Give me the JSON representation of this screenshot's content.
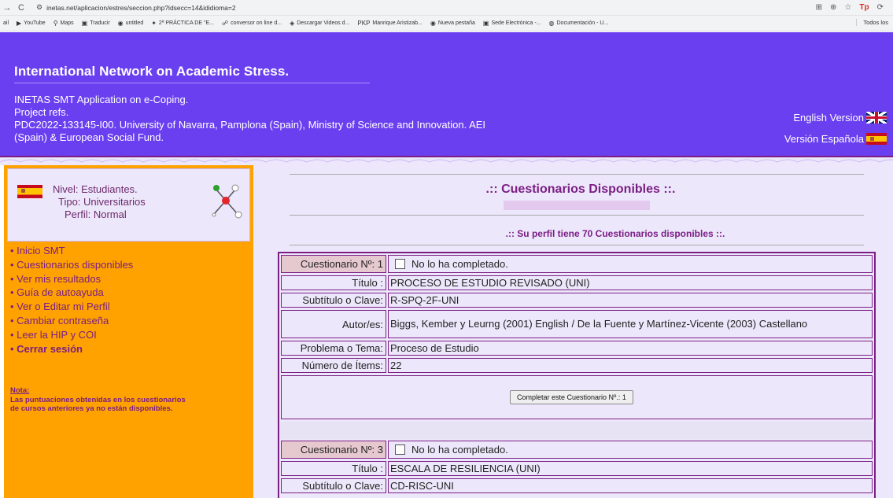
{
  "browser": {
    "nav": {
      "back": "→",
      "reload": "C"
    },
    "url": "inetas.net/aplicacion/estres/seccion.php?idsecc=14&ididioma=2",
    "right_icons": {
      "translate": "⊞",
      "zoom": "⊕",
      "star": "☆",
      "ext1": "Tp",
      "ext2": "⟳"
    }
  },
  "bookmarks": {
    "items": [
      {
        "icon": "",
        "label": "ail"
      },
      {
        "icon": "▶",
        "label": "YouTube"
      },
      {
        "icon": "⚲",
        "label": "Maps"
      },
      {
        "icon": "▣",
        "label": "Traducir"
      },
      {
        "icon": "◉",
        "label": "untitled"
      },
      {
        "icon": "✦",
        "label": "2ª PRÁCTICA DE \"E..."
      },
      {
        "icon": "☍",
        "label": "conversor on line d..."
      },
      {
        "icon": "◈",
        "label": "Descargar Videos d..."
      },
      {
        "icon": "PKP",
        "label": "Manrique Aristizab..."
      },
      {
        "icon": "◉",
        "label": "Nueva pestaña"
      },
      {
        "icon": "▣",
        "label": "Sede Electrónica -..."
      },
      {
        "icon": "◍",
        "label": "Documentación - U..."
      }
    ],
    "all": "Todos los"
  },
  "header": {
    "title": "International Network on Academic Stress.",
    "lines": [
      "INETAS SMT Application on e-Coping.",
      "Project refs.",
      "PDC2022-133145-I00. University of Navarra, Pamplona (Spain), Ministry of Science and Innovation. AEI",
      "(Spain) & European Social Fund."
    ],
    "lang_en": "English Version",
    "lang_es": "Versión Española"
  },
  "profile": {
    "nivel": "Nivel: Estudiantes.",
    "tipo": "Tipo: Universitarios",
    "perfil": "Perfil: Normal"
  },
  "sidebar_nav": [
    "• Inicio SMT",
    "• Cuestionarios disponibles",
    "• Ver mis resultados",
    "• Guía de autoayuda",
    "• Ver o Editar mi Perfil",
    "• Cambiar contraseña",
    "• Leer la HIP y COI",
    "• Cerrar sesión"
  ],
  "note": {
    "label": "Nota:",
    "line1": "Las puntuaciones obtenidas en los cuestionarios",
    "line2": "de cursos anteriores ya no están disponibles."
  },
  "main": {
    "title": ".:: Cuestionarios Disponibles ::.",
    "profile_count": ".:: Su perfil tiene 70 Cuestionarios disponibles ::."
  },
  "questionnaires": [
    {
      "number_label": "Cuestionario Nº: 1",
      "status": "No lo ha completado.",
      "fields": [
        {
          "label": "Título :",
          "value": "PROCESO DE ESTUDIO REVISADO (UNI)"
        },
        {
          "label": "Subtítulo o Clave:",
          "value": "R-SPQ-2F-UNI"
        },
        {
          "label": "Autor/es:",
          "value": "Biggs, Kember y Leurng (2001) English / De la Fuente y Martínez-Vicente (2003) Castellano"
        },
        {
          "label": "Problema o Tema:",
          "value": "Proceso de Estudio"
        },
        {
          "label": "Número de Ítems:",
          "value": "22"
        }
      ],
      "button": "Completar este Cuestionario Nº.: 1"
    },
    {
      "number_label": "Cuestionario Nº: 3",
      "status": "No lo ha completado.",
      "fields": [
        {
          "label": "Título :",
          "value": "ESCALA DE RESILIENCIA (UNI)"
        },
        {
          "label": "Subtítulo o Clave:",
          "value": "CD-RISC-UNI"
        }
      ]
    }
  ],
  "colors": {
    "header_bg": "#6a3ff0",
    "sidebar_bg": "#ffa200",
    "content_bg": "#ede7fb",
    "accent_text": "#7a1e84"
  }
}
